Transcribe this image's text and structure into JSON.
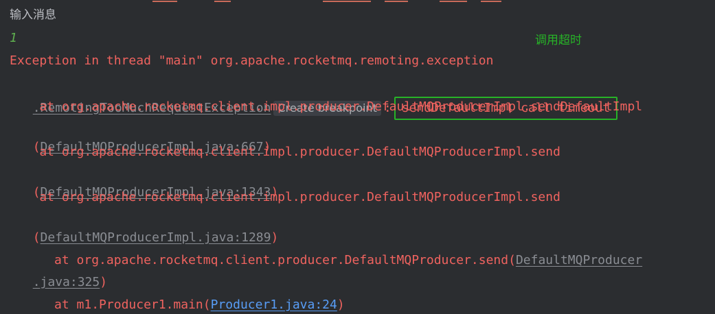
{
  "console": {
    "input_title": "输入消息",
    "input_value": "1",
    "annotation": "调用超时",
    "exception_line": "Exception in thread \"main\" org.apache.rocketmq.remoting.exception",
    "exception_class_prefix": ".",
    "exception_class": "RemotingTooMuchRequestException",
    "breakpoint_hint": "Create breakpoint",
    "colon": ":",
    "message": "sendDefaultImpl call timeout",
    "frames": [
      {
        "method": "    at org.apache.rocketmq.client.impl.producer.DefaultMQProducerImpl.sendDefaultImpl",
        "open": "(",
        "location": "DefaultMQProducerImpl.java:667",
        "close": ")"
      },
      {
        "method": "    at org.apache.rocketmq.client.impl.producer.DefaultMQProducerImpl.send",
        "open": "(",
        "location": "DefaultMQProducerImpl.java:1343",
        "close": ")"
      },
      {
        "method": "    at org.apache.rocketmq.client.impl.producer.DefaultMQProducerImpl.send",
        "open": "(",
        "location": "DefaultMQProducerImpl.java:1289",
        "close": ")"
      },
      {
        "method": "    at org.apache.rocketmq.client.producer.DefaultMQProducer.send(",
        "location_part1": "DefaultMQProducer",
        "location_part2": ".java:325",
        "close": ")"
      },
      {
        "method": "    at m1.Producer1.main(",
        "location": "Producer1.java:24",
        "close": ")"
      }
    ]
  },
  "colors": {
    "background": "#2b2d30",
    "error_text": "#f0635f",
    "annotation": "#27b327",
    "project_link": "#589df6",
    "library_link": "#8a8d93"
  }
}
